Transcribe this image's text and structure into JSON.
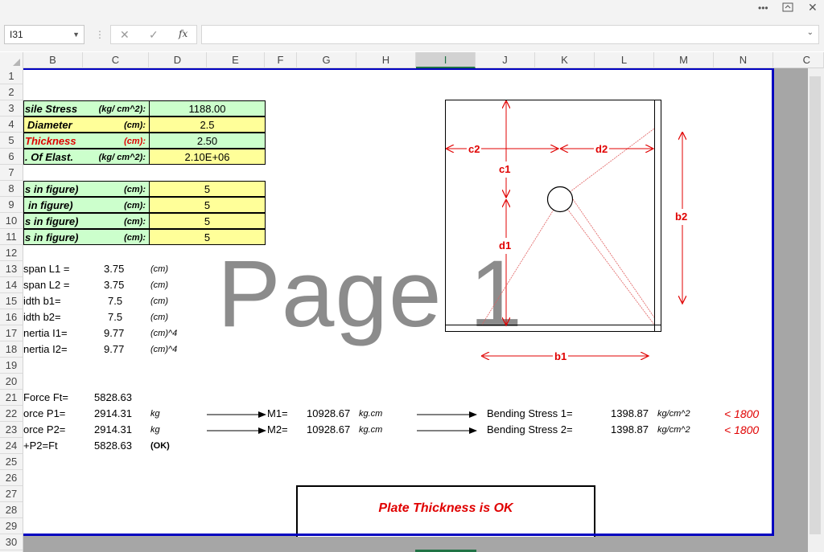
{
  "window": {
    "more_icon": "more-options-icon",
    "restore_icon": "ribbon-display-icon",
    "close_icon": "close-icon"
  },
  "formula_bar": {
    "name_box": "I31",
    "formula": "",
    "fx_label": "fx"
  },
  "columns": [
    "B",
    "C",
    "D",
    "E",
    "F",
    "G",
    "H",
    "I",
    "J",
    "K",
    "L",
    "M",
    "N",
    "C"
  ],
  "selected_column": "I",
  "rows": [
    "1",
    "2",
    "3",
    "4",
    "5",
    "6",
    "7",
    "8",
    "9",
    "10",
    "11",
    "12",
    "13",
    "14",
    "15",
    "16",
    "17",
    "18",
    "19",
    "20",
    "21",
    "22",
    "23",
    "24",
    "25",
    "26",
    "27",
    "28",
    "29",
    "30"
  ],
  "inputs": [
    {
      "label": "sile Stress",
      "label_color": "#000000",
      "unit": "(kg/ cm^2):",
      "value": "1188.00",
      "fill": "green"
    },
    {
      "label": "Diameter",
      "label_color": "#000000",
      "unit": "(cm):",
      "value": "2.5",
      "fill": "yellow"
    },
    {
      "label": "Thickness",
      "label_color": "#e00000",
      "unit": "(cm):",
      "value": "2.50",
      "fill": "green"
    },
    {
      "label": ". Of Elast.",
      "label_color": "#000000",
      "unit": "(kg/ cm^2):",
      "value": "2.10E+06",
      "fill": "yellow"
    }
  ],
  "dims": [
    {
      "label": "s in figure)",
      "unit": "(cm):",
      "value": "5",
      "label_fill": "green"
    },
    {
      "label": "in figure)",
      "unit": "(cm):",
      "value": "5",
      "label_fill": "green"
    },
    {
      "label": "s in figure)",
      "unit": "(cm):",
      "value": "5",
      "label_fill": "green"
    },
    {
      "label": "s in figure)",
      "unit": "(cm):",
      "value": "5",
      "label_fill": "green"
    }
  ],
  "geometry": [
    {
      "label": "span L1 =",
      "value": "3.75",
      "unit": "(cm)"
    },
    {
      "label": "span L2 =",
      "value": "3.75",
      "unit": "(cm)"
    },
    {
      "label": "idth b1=",
      "value": "7.5",
      "unit": "(cm)"
    },
    {
      "label": "idth b2=",
      "value": "7.5",
      "unit": "(cm)"
    },
    {
      "label": "nertia I1=",
      "value": "9.77",
      "unit": "(cm)^4"
    },
    {
      "label": "nertia I2=",
      "value": "9.77",
      "unit": "(cm)^4"
    }
  ],
  "forces": {
    "ft": {
      "label": "Force Ft=",
      "value": "5828.63"
    },
    "p1": {
      "label": "orce P1=",
      "value": "2914.31",
      "unit": "kg",
      "m_label": "M1=",
      "m_value": "10928.67",
      "m_unit": "kg.cm",
      "bs_label": "Bending Stress 1=",
      "bs_value": "1398.87",
      "bs_unit": "kg/cm^2",
      "limit": "< 1800"
    },
    "p2": {
      "label": "orce P2=",
      "value": "2914.31",
      "unit": "kg",
      "m_label": "M2=",
      "m_value": "10928.67",
      "m_unit": "kg.cm",
      "bs_label": "Bending Stress 2=",
      "bs_value": "1398.87",
      "bs_unit": "kg/cm^2",
      "limit": "< 1800"
    },
    "sum": {
      "label": "+P2=Ft",
      "value": "5828.63",
      "check": "(OK)"
    }
  },
  "diagram_labels": {
    "c2": "c2",
    "d2": "d2",
    "c1": "c1",
    "d1": "d1",
    "b2": "b2",
    "b1": "b1"
  },
  "watermark": "Page 1",
  "result": "Plate Thickness is OK"
}
